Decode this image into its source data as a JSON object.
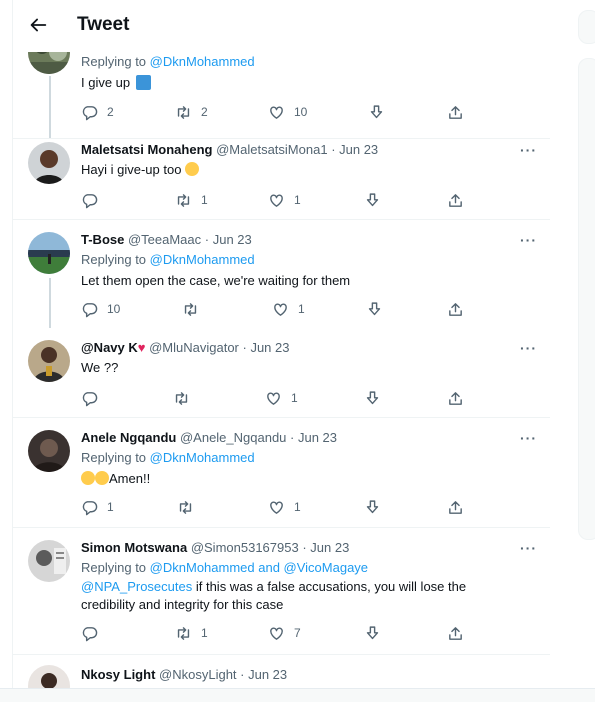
{
  "header": {
    "title": "Tweet"
  },
  "tweets": [
    {
      "reply_prefix": "Replying to",
      "reply_handles": "@DknMohammed",
      "text": "I give up",
      "counts": {
        "replies": "2",
        "retweets": "2",
        "likes": "10"
      }
    },
    {
      "name": "Maletsatsi Monaheng",
      "handle": "@MaletsatsiMona1",
      "date": "· Jun 23",
      "text": "Hayi i give-up too",
      "counts": {
        "replies": "",
        "retweets": "1",
        "likes": "1"
      }
    },
    {
      "name": "T-Bose",
      "handle": "@TeeaMaac",
      "date": "· Jun 23",
      "reply_prefix": "Replying to",
      "reply_handles": "@DknMohammed",
      "text": "Let them open the case, we're waiting for them",
      "counts": {
        "replies": "10",
        "retweets": "",
        "likes": "1"
      }
    },
    {
      "name": "@Navy K",
      "name_suffix": "♥",
      "handle": "@MluNavigator",
      "date": "· Jun 23",
      "text": "We ??",
      "counts": {
        "replies": "",
        "retweets": "",
        "likes": "1"
      }
    },
    {
      "name": "Anele Ngqandu",
      "handle": "@Anele_Ngqandu",
      "date": "· Jun 23",
      "reply_prefix": "Replying to",
      "reply_handles": "@DknMohammed",
      "text": "Amen!!",
      "counts": {
        "replies": "1",
        "retweets": "",
        "likes": "1"
      }
    },
    {
      "name": "Simon Motswana",
      "handle": "@Simon53167953",
      "date": "· Jun 23",
      "reply_prefix": "Replying to",
      "reply_handles": "@DknMohammed and @VicoMagaye",
      "text_mention": "@NPA_Prosecutes",
      "text": " if this was a false accusations, you will lose the credibility and integrity for this case",
      "counts": {
        "replies": "",
        "retweets": "1",
        "likes": "7"
      }
    },
    {
      "name": "Nkosy Light",
      "handle": "@NkosyLight",
      "date": "· Jun 23"
    }
  ],
  "icons": {
    "back": "arrow-left-icon",
    "reply": "speech-bubble-icon",
    "retweet": "retweet-icon",
    "like": "heart-icon",
    "bookmark": "download-arrow-icon",
    "share": "share-icon",
    "more": "more-dots-icon"
  },
  "colors": {
    "accent": "#1d9bf0",
    "muted": "#536471",
    "text": "#0f1419",
    "heart": "#e0245e"
  }
}
